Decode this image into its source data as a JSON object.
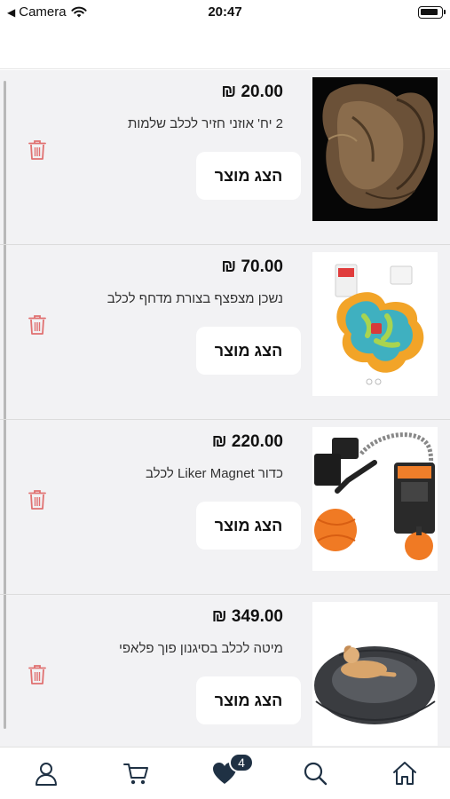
{
  "status_bar": {
    "back_app": "Camera",
    "time": "20:47"
  },
  "wishlist": {
    "items": [
      {
        "price": "20.00 ₪",
        "name": "2 יח' אוזני חזיר לכלב שלמות",
        "view_label": "הצג מוצר",
        "image_icon": "pig-ears-photo"
      },
      {
        "price": "70.00 ₪",
        "name": "נשכן מצפצף בצורת מדחף לכלב",
        "view_label": "הצג מוצר",
        "image_icon": "propeller-toy-photo"
      },
      {
        "price": "220.00 ₪",
        "name": "כדור Liker Magnet לכלב",
        "view_label": "הצג מוצר",
        "image_icon": "liker-ball-photo"
      },
      {
        "price": "349.00 ₪",
        "name": "מיטה לכלב בסיגנון פוך פלאפי",
        "view_label": "הצג מוצר",
        "image_icon": "dog-bed-photo"
      }
    ]
  },
  "tabbar": {
    "tabs": [
      "profile-icon",
      "cart-icon",
      "heart-icon",
      "search-icon",
      "home-icon"
    ],
    "wishlist_count": "4"
  },
  "colors": {
    "trash": "#e07070",
    "badge": "#1f3144",
    "icon": "#1f3144",
    "list_bg": "#f2f2f4"
  }
}
